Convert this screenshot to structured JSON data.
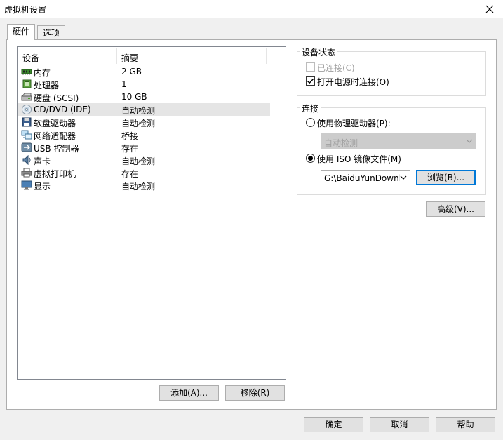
{
  "window": {
    "title": "虚拟机设置"
  },
  "tabs": [
    {
      "label": "硬件",
      "active": true
    },
    {
      "label": "选项",
      "active": false
    }
  ],
  "device_list": {
    "headers": {
      "device": "设备",
      "summary": "摘要"
    },
    "rows": [
      {
        "name": "内存",
        "summary": "2 GB",
        "icon": "memory-icon"
      },
      {
        "name": "处理器",
        "summary": "1",
        "icon": "processor-icon"
      },
      {
        "name": "硬盘 (SCSI)",
        "summary": "10 GB",
        "icon": "hard-disk-icon"
      },
      {
        "name": "CD/DVD (IDE)",
        "summary": "自动检测",
        "icon": "cd-dvd-icon",
        "selected": true
      },
      {
        "name": "软盘驱动器",
        "summary": "自动检测",
        "icon": "floppy-icon"
      },
      {
        "name": "网络适配器",
        "summary": "桥接",
        "icon": "network-adapter-icon"
      },
      {
        "name": "USB 控制器",
        "summary": "存在",
        "icon": "usb-icon"
      },
      {
        "name": "声卡",
        "summary": "自动检测",
        "icon": "sound-card-icon"
      },
      {
        "name": "虚拟打印机",
        "summary": "存在",
        "icon": "printer-icon"
      },
      {
        "name": "显示",
        "summary": "自动检测",
        "icon": "display-icon"
      }
    ]
  },
  "list_buttons": {
    "add": "添加(A)...",
    "remove": "移除(R)"
  },
  "device_status": {
    "title": "设备状态",
    "connected": {
      "label": "已连接(C)",
      "checked": false,
      "disabled": true
    },
    "connect_on_power": {
      "label": "打开电源时连接(O)",
      "checked": true
    }
  },
  "connection": {
    "title": "连接",
    "physical": {
      "label": "使用物理驱动器(P):",
      "selected": false
    },
    "physical_select": {
      "value": "自动检测",
      "disabled": true
    },
    "iso": {
      "label": "使用 ISO 镜像文件(M)",
      "selected": true
    },
    "iso_select": {
      "value": "G:\\BaiduYunDownl"
    },
    "browse": "浏览(B)..."
  },
  "advanced": "高级(V)...",
  "footer": {
    "ok": "确定",
    "cancel": "取消",
    "help": "帮助"
  },
  "colors": {
    "selection": "#e5e5e5",
    "focus_border": "#0078d7",
    "button_face": "#e1e1e1",
    "disabled_select": "#cccccc"
  }
}
